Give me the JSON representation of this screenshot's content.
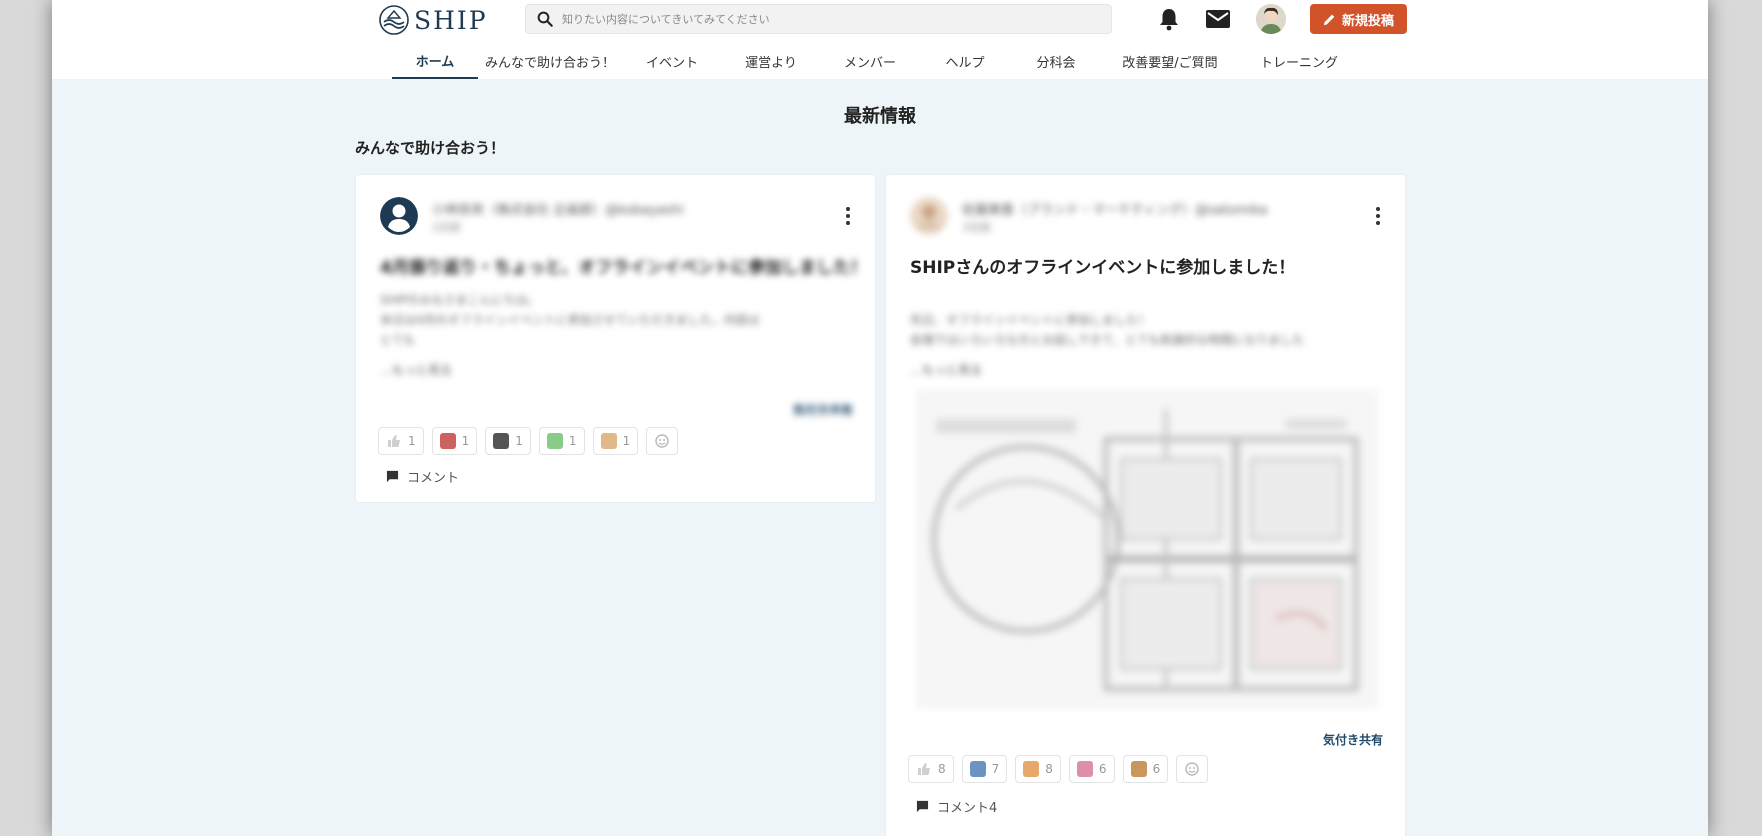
{
  "header": {
    "logo_text": "SHIP",
    "search_placeholder": "知りたい内容についてきいてみてください",
    "new_post_label": "新規投稿",
    "icons": [
      "bell-icon",
      "mail-icon",
      "search-icon",
      "pencil-icon"
    ]
  },
  "nav": {
    "items": [
      {
        "label": "ホーム",
        "active": true
      },
      {
        "label": "みんなで助け合おう！"
      },
      {
        "label": "イベント"
      },
      {
        "label": "運営より"
      },
      {
        "label": "メンバー"
      },
      {
        "label": "ヘルプ"
      },
      {
        "label": "分科会"
      },
      {
        "label": "改善要望/ご質問"
      },
      {
        "label": "トレーニング"
      }
    ]
  },
  "main": {
    "section_title": "最新情報",
    "subsection_title": "みんなで助け合おう！"
  },
  "cards": [
    {
      "author": "小林奈央（株式会社 企画部）@kobayashi",
      "date": "2日前",
      "title": "4月振り返り・ちょっと、オフラインイベントに参加しました！",
      "body_lines": [
        "SHIPのみなさまこんにちは。",
        "本日は4月のオフラインイベントに参加させていただきました。内容は",
        "とても"
      ],
      "read_more": "…もっと見る",
      "tag": "気付き共有",
      "reactions": [
        {
          "count": "1",
          "color": "#cfcfcf"
        },
        {
          "count": "1",
          "color": "#c03a3a"
        },
        {
          "count": "1",
          "color": "#2a2a2a"
        },
        {
          "count": "1",
          "color": "#6bbf6b"
        },
        {
          "count": "1",
          "color": "#d9a86a"
        }
      ],
      "comment_label": "コメント"
    },
    {
      "author": "佐藤美香（ブランド・マーケティング）@satomika",
      "date": "3日前",
      "title": "SHIPさんのオフラインイベントに参加しました！",
      "body_lines": [
        "先日、オフラインイベントに参加しました！",
        "会場ではいろいろな方とお話しできて、とても刺激的な時間になりました"
      ],
      "read_more": "…もっと見る",
      "tag": "気付き共有",
      "reactions": [
        {
          "count": "8",
          "color": "#cfcfcf"
        },
        {
          "count": "7",
          "color": "#3a6fb0"
        },
        {
          "count": "8",
          "color": "#e08a3a"
        },
        {
          "count": "6",
          "color": "#d06a8a"
        },
        {
          "count": "6",
          "color": "#b8722a"
        }
      ],
      "comment_label": "コメント4"
    }
  ]
}
